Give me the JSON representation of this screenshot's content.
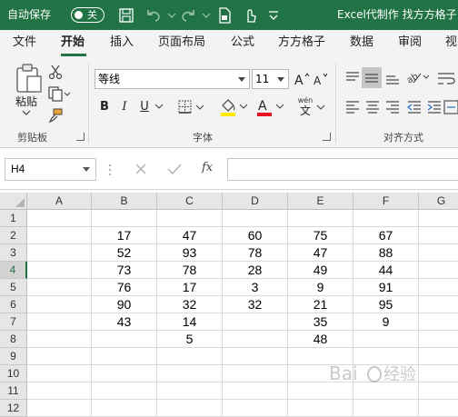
{
  "title_bar": {
    "autosave_label": "自动保存",
    "autosave_state": "关",
    "window_title": "Excel代制作 找方方格子"
  },
  "ribbon_tabs": [
    {
      "label": "文件"
    },
    {
      "label": "开始",
      "active": true
    },
    {
      "label": "插入"
    },
    {
      "label": "页面布局"
    },
    {
      "label": "公式"
    },
    {
      "label": "方方格子"
    },
    {
      "label": "数据"
    },
    {
      "label": "审阅"
    },
    {
      "label": "视"
    }
  ],
  "ribbon": {
    "paste_label": "粘贴",
    "clipboard_label": "剪贴板",
    "font_name": "等线",
    "font_size": "11",
    "font_label": "字体",
    "bold": "B",
    "italic": "I",
    "underline": "U",
    "wen_label": "wén",
    "wen_char": "文",
    "align_label": "对齐方式",
    "font_color": "#e81123",
    "fill_color": "#ffeb00"
  },
  "formula_bar": {
    "name_box": "H4",
    "fx": "fx",
    "value": ""
  },
  "sheet": {
    "columns": [
      "A",
      "B",
      "C",
      "D",
      "E",
      "F",
      "G"
    ],
    "rows": [
      "1",
      "2",
      "3",
      "4",
      "5",
      "6",
      "7",
      "8",
      "9",
      "10",
      "11",
      "12"
    ],
    "selected_row": "4",
    "cells": {
      "B": [
        "",
        "17",
        "52",
        "73",
        "76",
        "90",
        "43",
        "",
        "",
        "",
        "",
        ""
      ],
      "C": [
        "",
        "47",
        "93",
        "78",
        "17",
        "32",
        "14",
        "5",
        "",
        "",
        "",
        ""
      ],
      "D": [
        "",
        "60",
        "78",
        "28",
        "3",
        "32",
        "",
        "",
        "",
        "",
        "",
        ""
      ],
      "E": [
        "",
        "75",
        "47",
        "49",
        "9",
        "21",
        "35",
        "48",
        "",
        "",
        "",
        ""
      ],
      "F": [
        "",
        "67",
        "88",
        "44",
        "91",
        "95",
        "9",
        "",
        "",
        "",
        "",
        ""
      ]
    }
  },
  "accent_color": "#217346"
}
